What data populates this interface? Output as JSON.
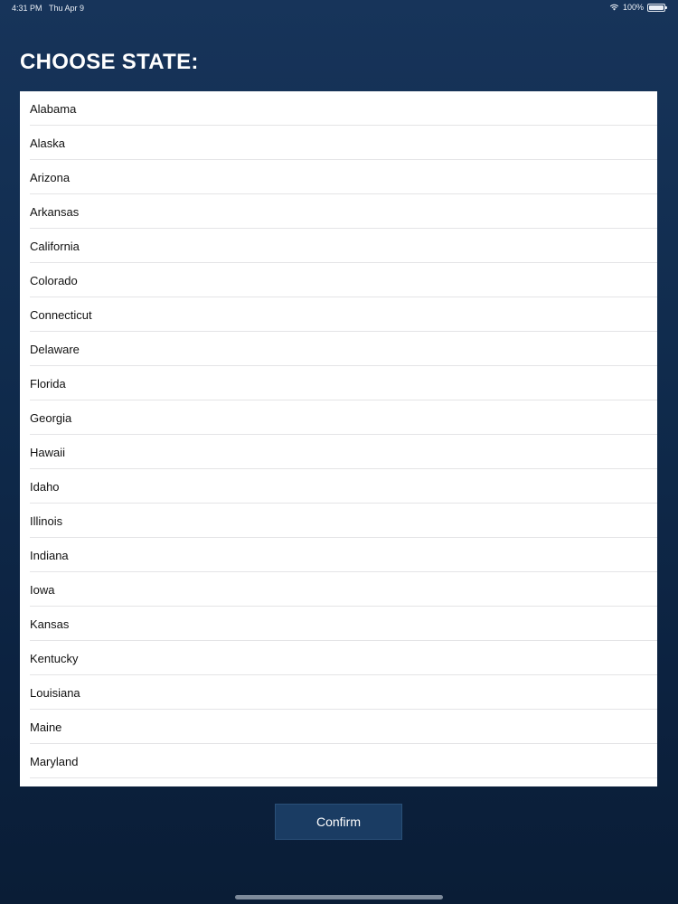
{
  "status_bar": {
    "time": "4:31 PM",
    "date": "Thu Apr 9",
    "battery_percent": "100%"
  },
  "page": {
    "title": "CHOOSE STATE:"
  },
  "states": [
    "Alabama",
    "Alaska",
    "Arizona",
    "Arkansas",
    "California",
    "Colorado",
    "Connecticut",
    "Delaware",
    "Florida",
    "Georgia",
    "Hawaii",
    "Idaho",
    "Illinois",
    "Indiana",
    "Iowa",
    "Kansas",
    "Kentucky",
    "Louisiana",
    "Maine",
    "Maryland"
  ],
  "actions": {
    "confirm_label": "Confirm"
  },
  "icons": {
    "wifi": "wifi-icon",
    "battery": "battery-icon"
  },
  "colors": {
    "background_top": "#17345a",
    "background_bottom": "#0a1d36",
    "button": "#1a3c63"
  }
}
